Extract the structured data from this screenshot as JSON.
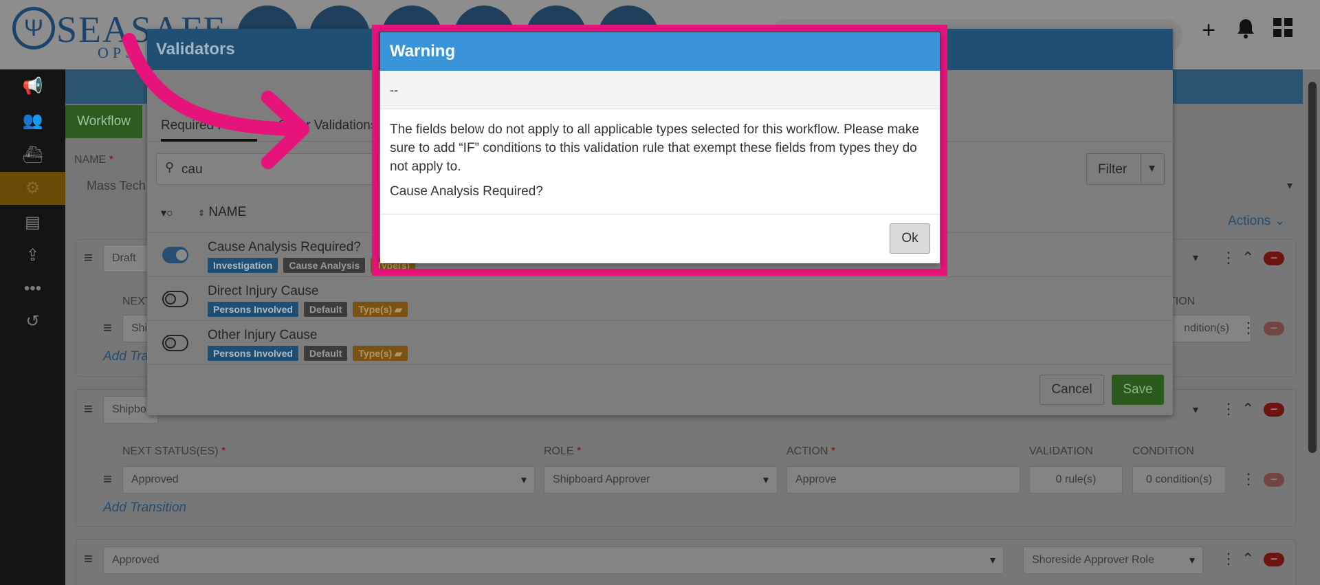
{
  "app": {
    "logo_text": "SEASAFE",
    "logo_sub": "OPS"
  },
  "sidebar": {
    "items": [
      {
        "icon": "megaphone-icon"
      },
      {
        "icon": "users-icon"
      },
      {
        "icon": "ship-icon"
      },
      {
        "icon": "gears-icon",
        "active": true
      },
      {
        "icon": "document-icon"
      },
      {
        "icon": "upload-icon"
      },
      {
        "icon": "more-icon"
      },
      {
        "icon": "history-icon"
      }
    ]
  },
  "background": {
    "workflow_tab": "Workflow",
    "name_label": "NAME",
    "name_value": "Mass Tech",
    "actions_label": "Actions",
    "status_rows": [
      {
        "status": "Draft"
      },
      {
        "status": "Shipbo"
      },
      {
        "status": "Approved",
        "role": "Shoreside Approver Role"
      }
    ],
    "transition_labels": {
      "next_statuses": "NEXT STATUS(ES)",
      "role": "ROLE",
      "action": "ACTION",
      "validation": "VALIDATION",
      "condition": "CONDITION"
    },
    "row1_next_partial": "NEXT",
    "row1_condition_partial": "TION",
    "row1_field_partial": "Shi",
    "row1_condition_value_partial": "ndition(s)",
    "add_transition_partial": "Add Tra",
    "transition2": {
      "next_status": "Approved",
      "role": "Shipboard Approver",
      "action": "Approve",
      "validation": "0 rule(s)",
      "condition": "0 condition(s)"
    },
    "add_transition": "Add Transition"
  },
  "validators": {
    "title": "Validators",
    "tabs": [
      {
        "label": "Required Fields",
        "active": true
      },
      {
        "label": "Other Validations",
        "active": false
      }
    ],
    "search_value": "cau",
    "filter_label": "Filter",
    "column_name": "NAME",
    "rows": [
      {
        "name": "Cause Analysis Required?",
        "enabled": true,
        "badges": [
          "Investigation",
          "Cause Analysis",
          "Type(s)"
        ]
      },
      {
        "name": "Direct Injury Cause",
        "enabled": false,
        "badges": [
          "Persons Involved",
          "Default",
          "Type(s)"
        ]
      },
      {
        "name": "Other Injury Cause",
        "enabled": false,
        "badges": [
          "Persons Involved",
          "Default",
          "Type(s)"
        ]
      }
    ],
    "cancel_label": "Cancel",
    "save_label": "Save"
  },
  "warning": {
    "title": "Warning",
    "subtitle": "--",
    "message": "The fields below do not apply to all applicable types selected for this workflow. Please make sure to add “IF” conditions to this validation rule that exempt these fields from types they do not apply to.",
    "field": "Cause Analysis Required?",
    "ok_label": "Ok"
  },
  "colors": {
    "highlight": "#e5137a",
    "warning_header": "#3a95d8",
    "save": "#2b5a1d"
  }
}
